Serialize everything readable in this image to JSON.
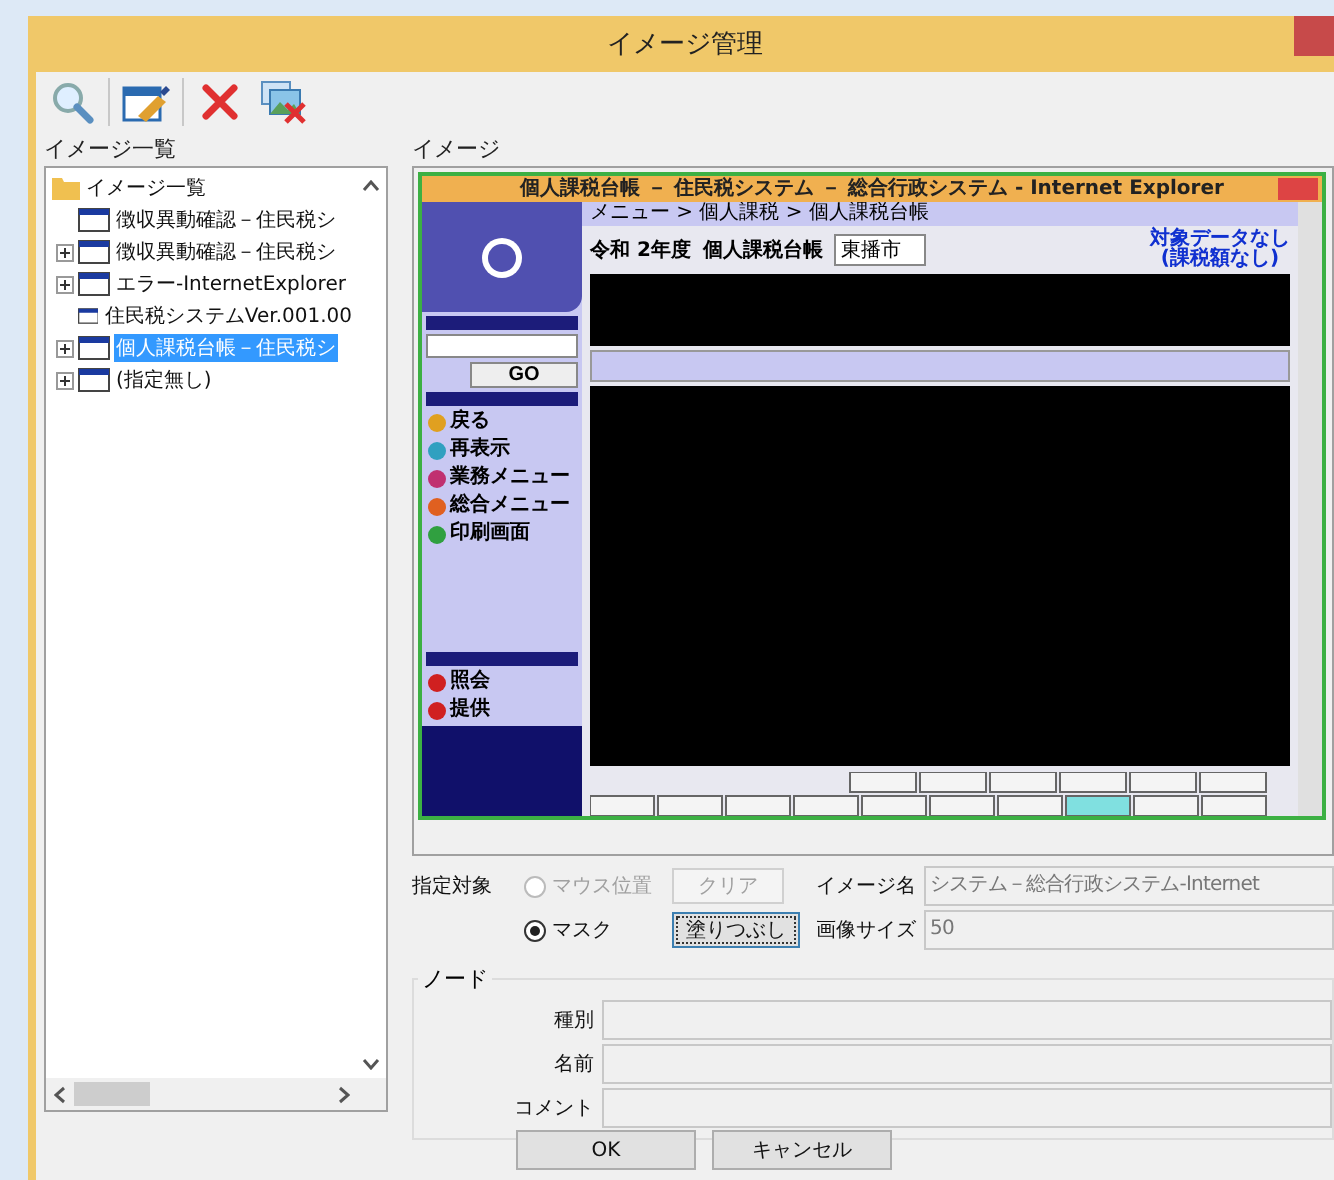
{
  "window": {
    "title": "イメージ管理"
  },
  "toolbar": {
    "buttons": [
      {
        "kind": "search"
      },
      {
        "kind": "edit"
      },
      {
        "kind": "delete"
      },
      {
        "kind": "delete_image"
      }
    ]
  },
  "image_list": {
    "label": "イメージ一覧",
    "root": {
      "label": "イメージ一覧",
      "expanded": true,
      "children": [
        {
          "label": "徴収異動確認－住民税シ",
          "expandable": false,
          "selected": false
        },
        {
          "label": "徴収異動確認－住民税シ",
          "expandable": true,
          "selected": false
        },
        {
          "label": "エラー-InternetExplorer",
          "expandable": true,
          "selected": false
        },
        {
          "label": "住民税システムVer.001.00",
          "expandable": false,
          "selected": false
        },
        {
          "label": "個人課税台帳－住民税シ",
          "expandable": true,
          "selected": true
        },
        {
          "label": "(指定無し)",
          "expandable": true,
          "selected": false
        }
      ]
    }
  },
  "image": {
    "label": "イメージ",
    "screenshot": {
      "title": "個人課税台帳 － 住民税システム － 総合行政システム - Internet Explorer",
      "breadcrumb": "メニュー > 個人課税 > 個人課税台帳",
      "year": "令和 2年度",
      "page_title": "個人課税台帳",
      "city": "東播市",
      "notice": [
        "対象データなし",
        "(課税額なし)"
      ],
      "go": "GO",
      "menu": [
        {
          "label": "戻る",
          "color": "#e0a020"
        },
        {
          "label": "再表示",
          "color": "#30a0c0"
        },
        {
          "label": "業務メニュー",
          "color": "#c03070"
        },
        {
          "label": "総合メニュー",
          "color": "#e06020"
        },
        {
          "label": "印刷画面",
          "color": "#30a040"
        }
      ],
      "links": [
        {
          "label": "照会"
        },
        {
          "label": "提供"
        }
      ]
    }
  },
  "target": {
    "label": "指定対象",
    "options": [
      {
        "label": "マウス位置",
        "selected": false,
        "disabled": true
      },
      {
        "label": "マスク",
        "selected": true,
        "disabled": false
      }
    ],
    "buttons": [
      {
        "label": "クリア",
        "disabled": true,
        "focused": false
      },
      {
        "label": "塗りつぶし",
        "disabled": false,
        "focused": true
      }
    ]
  },
  "fields": [
    {
      "label": "イメージ名",
      "value": "システム－総合行政システム-Internet"
    },
    {
      "label": "画像サイズ",
      "value": "50"
    }
  ],
  "node": {
    "label": "ノード",
    "fields": [
      {
        "label": "種別"
      },
      {
        "label": "名前"
      },
      {
        "label": "コメント"
      }
    ]
  },
  "buttons": [
    {
      "label": "OK"
    },
    {
      "label": "キャンセル"
    }
  ]
}
